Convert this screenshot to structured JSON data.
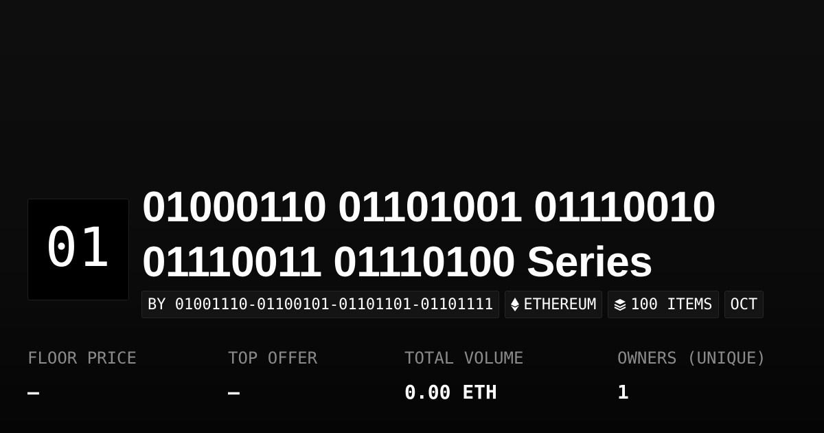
{
  "avatar": {
    "text": "01"
  },
  "collection": {
    "title": "01000110 01101001 01110010 01110011 01110100 Series"
  },
  "badges": {
    "creator": "BY 01001110-01100101-01101101-01101111",
    "chain": "ETHEREUM",
    "items": "100 ITEMS",
    "date": "OCT"
  },
  "stats": [
    {
      "label": "FLOOR PRICE",
      "value": "—"
    },
    {
      "label": "TOP OFFER",
      "value": "—"
    },
    {
      "label": "TOTAL VOLUME",
      "value": "0.00 ETH"
    },
    {
      "label": "OWNERS (UNIQUE)",
      "value": "1"
    }
  ],
  "icons": {
    "chain": "ethereum-icon",
    "items": "layers-icon"
  },
  "colors": {
    "background": "#0b0b0b",
    "text": "#ffffff",
    "muted": "#8a8a8a",
    "badge_bg": "#141414"
  }
}
